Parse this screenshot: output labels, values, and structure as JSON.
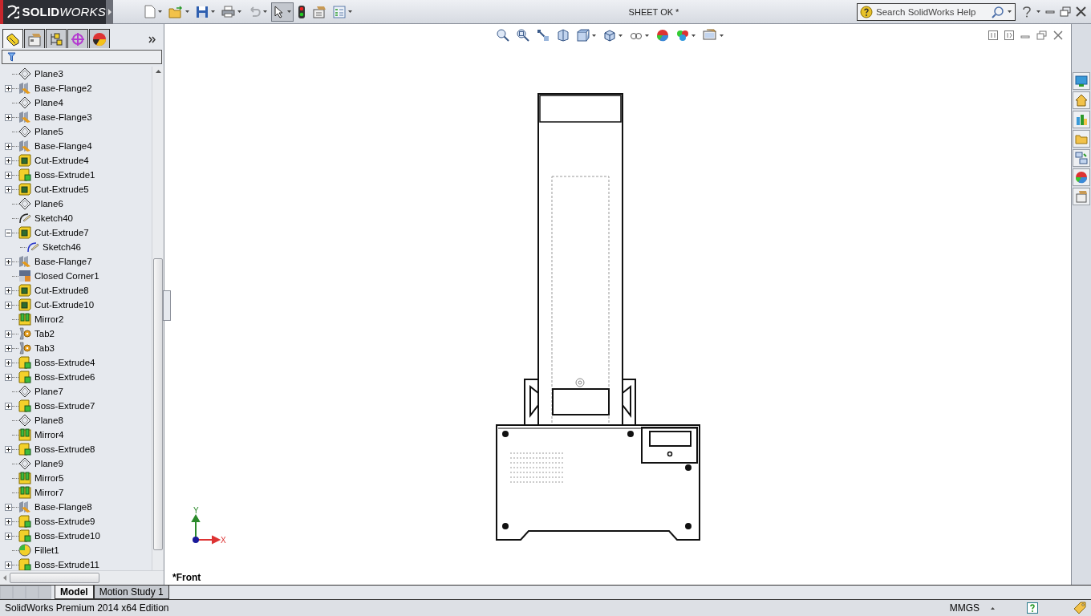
{
  "app": {
    "logo": "**SOLID**WORKS",
    "document_title": "SHEET OK *",
    "search": {
      "placeholder": "Search SolidWorks Help"
    }
  },
  "panel_tabs": [
    {
      "kind": "features",
      "selected": true
    },
    {
      "kind": "properties",
      "selected": false
    },
    {
      "kind": "configurations",
      "selected": false
    },
    {
      "kind": "dimxpert",
      "selected": false
    },
    {
      "kind": "appearance",
      "selected": false
    }
  ],
  "feature_tree": [
    {
      "label": "Plane3",
      "kind": "plane",
      "expandable": false
    },
    {
      "label": "Base-Flange2",
      "kind": "flange",
      "expandable": true,
      "expanded": false
    },
    {
      "label": "Plane4",
      "kind": "plane",
      "expandable": false
    },
    {
      "label": "Base-Flange3",
      "kind": "flange",
      "expandable": true,
      "expanded": false
    },
    {
      "label": "Plane5",
      "kind": "plane",
      "expandable": false
    },
    {
      "label": "Base-Flange4",
      "kind": "flange",
      "expandable": true,
      "expanded": false
    },
    {
      "label": "Cut-Extrude4",
      "kind": "cut",
      "expandable": true,
      "expanded": false
    },
    {
      "label": "Boss-Extrude1",
      "kind": "boss",
      "expandable": true,
      "expanded": false
    },
    {
      "label": "Cut-Extrude5",
      "kind": "cut",
      "expandable": true,
      "expanded": false
    },
    {
      "label": "Plane6",
      "kind": "plane",
      "expandable": false
    },
    {
      "label": "Sketch40",
      "kind": "sketch",
      "expandable": false
    },
    {
      "label": "Cut-Extrude7",
      "kind": "cut",
      "expandable": true,
      "expanded": true,
      "children": [
        {
          "label": "Sketch46",
          "kind": "sketch",
          "expandable": false
        }
      ]
    },
    {
      "label": "Base-Flange7",
      "kind": "flange",
      "expandable": true,
      "expanded": false
    },
    {
      "label": "Closed Corner1",
      "kind": "corner",
      "expandable": false
    },
    {
      "label": "Cut-Extrude8",
      "kind": "cut",
      "expandable": true,
      "expanded": false
    },
    {
      "label": "Cut-Extrude10",
      "kind": "cut",
      "expandable": true,
      "expanded": false
    },
    {
      "label": "Mirror2",
      "kind": "mirror",
      "expandable": false
    },
    {
      "label": "Tab2",
      "kind": "tab",
      "expandable": true,
      "expanded": false
    },
    {
      "label": "Tab3",
      "kind": "tab",
      "expandable": true,
      "expanded": false
    },
    {
      "label": "Boss-Extrude4",
      "kind": "boss",
      "expandable": true,
      "expanded": false
    },
    {
      "label": "Boss-Extrude6",
      "kind": "boss",
      "expandable": true,
      "expanded": false
    },
    {
      "label": "Plane7",
      "kind": "plane",
      "expandable": false
    },
    {
      "label": "Boss-Extrude7",
      "kind": "boss",
      "expandable": true,
      "expanded": false
    },
    {
      "label": "Plane8",
      "kind": "plane",
      "expandable": false
    },
    {
      "label": "Mirror4",
      "kind": "mirror",
      "expandable": false
    },
    {
      "label": "Boss-Extrude8",
      "kind": "boss",
      "expandable": true,
      "expanded": false
    },
    {
      "label": "Plane9",
      "kind": "plane",
      "expandable": false
    },
    {
      "label": "Mirror5",
      "kind": "mirror",
      "expandable": false
    },
    {
      "label": "Mirror7",
      "kind": "mirror",
      "expandable": false
    },
    {
      "label": "Base-Flange8",
      "kind": "flange",
      "expandable": true,
      "expanded": false
    },
    {
      "label": "Boss-Extrude9",
      "kind": "boss",
      "expandable": true,
      "expanded": false
    },
    {
      "label": "Boss-Extrude10",
      "kind": "boss",
      "expandable": true,
      "expanded": false
    },
    {
      "label": "Fillet1",
      "kind": "fillet",
      "expandable": false
    },
    {
      "label": "Boss-Extrude11",
      "kind": "boss",
      "expandable": true,
      "expanded": false
    }
  ],
  "viewport": {
    "view_name": "*Front",
    "triad": {
      "x": "X",
      "y": "Y"
    }
  },
  "bottom_tabs": [
    {
      "label": "Model",
      "selected": true
    },
    {
      "label": "Motion Study 1",
      "selected": false
    }
  ],
  "status_bar": {
    "product": "SolidWorks Premium 2014 x64 Edition",
    "units": "MMGS"
  }
}
